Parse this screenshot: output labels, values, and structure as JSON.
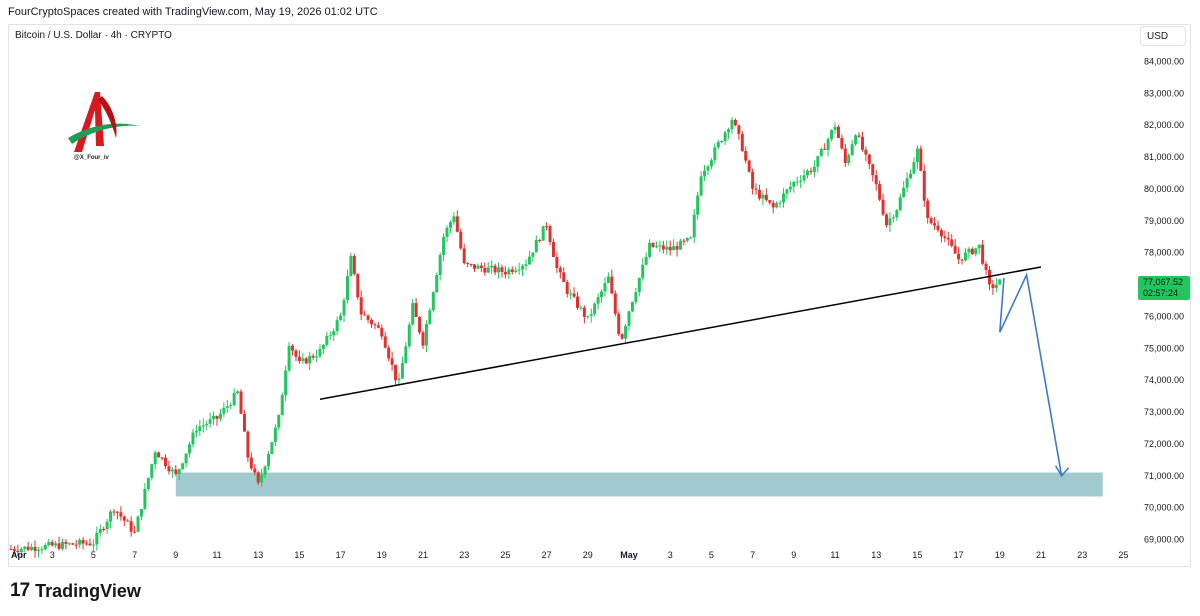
{
  "header": {
    "credit": "FourCryptoSpaces created with TradingView.com, May 19, 2026 01:02 UTC"
  },
  "symbol": {
    "title": "Bitcoin / U.S. Dollar · 4h · CRYPTO",
    "currency": "USD"
  },
  "price_tag": {
    "price": "77,067.52",
    "countdown": "02:57:24",
    "color": "#22c55e"
  },
  "logo": {
    "handle": "@X_Four_iv",
    "icon": "stylized-a-logo"
  },
  "footer": {
    "brand_mark": "17",
    "brand_name": "TradingView"
  },
  "colors": {
    "up": "#22c55e",
    "down": "#e0312f",
    "trendline": "#000000",
    "projection": "#3f7ac9",
    "support_zone": "#8fc1c4"
  },
  "chart_data": {
    "type": "candlestick",
    "title": "Bitcoin / U.S. Dollar · 4h · CRYPTO",
    "xlabel": "",
    "ylabel": "",
    "ylim": [
      68800,
      84800
    ],
    "y_ticks": [
      "84,000.00",
      "83,000.00",
      "82,000.00",
      "81,000.00",
      "80,000.00",
      "79,000.00",
      "78,000.00",
      "77,000.00",
      "76,000.00",
      "75,000.00",
      "74,000.00",
      "73,000.00",
      "72,000.00",
      "71,000.00",
      "70,000.00",
      "69,000.00"
    ],
    "x_ticks": [
      "Apr",
      "3",
      "5",
      "7",
      "9",
      "11",
      "13",
      "15",
      "17",
      "19",
      "21",
      "23",
      "25",
      "27",
      "29",
      "May",
      "3",
      "5",
      "7",
      "9",
      "11",
      "13",
      "15",
      "17",
      "19",
      "21",
      "23",
      "25"
    ],
    "price_path": [
      [
        "Apr 1",
        68700
      ],
      [
        "Apr 5",
        68900
      ],
      [
        "Apr 6",
        70000
      ],
      [
        "Apr 7",
        69200
      ],
      [
        "Apr 8",
        71800
      ],
      [
        "Apr 9",
        71000
      ],
      [
        "Apr 10",
        72500
      ],
      [
        "Apr 11",
        72800
      ],
      [
        "Apr 12",
        73600
      ],
      [
        "Apr 12.5",
        71600
      ],
      [
        "Apr 13",
        70700
      ],
      [
        "Apr 14",
        72800
      ],
      [
        "Apr 14.5",
        75200
      ],
      [
        "Apr 15",
        74500
      ],
      [
        "Apr 16",
        74900
      ],
      [
        "Apr 17",
        76000
      ],
      [
        "Apr 17.5",
        77800
      ],
      [
        "Apr 18",
        76100
      ],
      [
        "Apr 19",
        75500
      ],
      [
        "Apr 19.8",
        73800
      ],
      [
        "Apr 20.5",
        76300
      ],
      [
        "Apr 21",
        75200
      ],
      [
        "Apr 22",
        78500
      ],
      [
        "Apr 22.5",
        79200
      ],
      [
        "Apr 23",
        77600
      ],
      [
        "Apr 24",
        77500
      ],
      [
        "Apr 25",
        77400
      ],
      [
        "Apr 26",
        77700
      ],
      [
        "Apr 27",
        78900
      ],
      [
        "Apr 27.5",
        77500
      ],
      [
        "Apr 28",
        76800
      ],
      [
        "Apr 29",
        75900
      ],
      [
        "Apr 30",
        77200
      ],
      [
        "Apr 30.6",
        75200
      ],
      [
        "May 1",
        76200
      ],
      [
        "May 2",
        78200
      ],
      [
        "May 3",
        78100
      ],
      [
        "May 4",
        78400
      ],
      [
        "May 4.5",
        80500
      ],
      [
        "May 5",
        81000
      ],
      [
        "May 6",
        82200
      ],
      [
        "May 6.5",
        81300
      ],
      [
        "May 7",
        80000
      ],
      [
        "May 8",
        79400
      ],
      [
        "May 9",
        80200
      ],
      [
        "May 10",
        80700
      ],
      [
        "May 11",
        82000
      ],
      [
        "May 11.5",
        80800
      ],
      [
        "May 12",
        81800
      ],
      [
        "May 13",
        80100
      ],
      [
        "May 13.5",
        78900
      ],
      [
        "May 14",
        79400
      ],
      [
        "May 15",
        81200
      ],
      [
        "May 15.5",
        79000
      ],
      [
        "May 16",
        78800
      ],
      [
        "May 17",
        77800
      ],
      [
        "May 18",
        78200
      ],
      [
        "May 18.5",
        76900
      ],
      [
        "May 19",
        77070
      ]
    ],
    "annotations": {
      "support_zone": {
        "from": "Apr 9",
        "to": "May 24",
        "y_low": 70350,
        "y_high": 71100
      },
      "trendline": {
        "from": [
          "Apr 16",
          73400
        ],
        "to": [
          "May 21",
          77550
        ]
      },
      "projection": [
        [
          "May 19.2",
          77200
        ],
        [
          "May 19",
          75500
        ],
        [
          "May 20.3",
          77300
        ],
        [
          "May 22",
          71000
        ]
      ]
    },
    "last_price": 77067.52,
    "grid": false
  }
}
